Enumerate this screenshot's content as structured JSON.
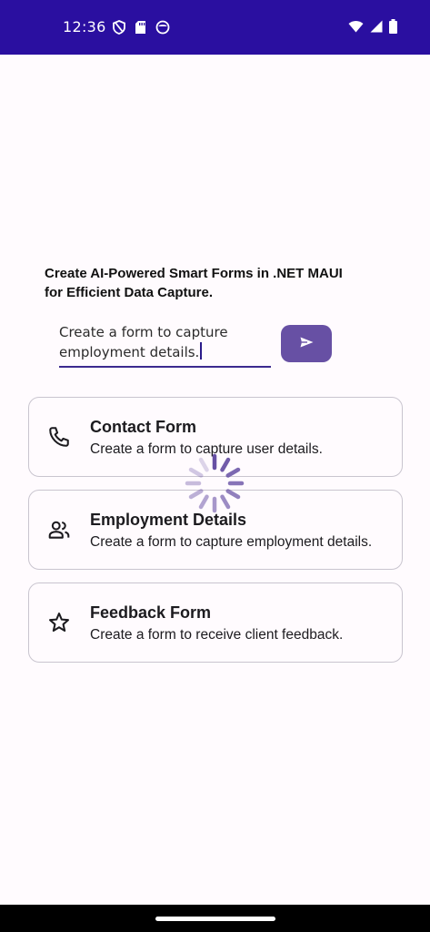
{
  "status_bar": {
    "time": "12:36",
    "left_icons": [
      "shield-icon",
      "sd-card-icon",
      "app-notification-icon"
    ],
    "right_icons": [
      "wifi-icon",
      "cell-signal-icon",
      "battery-icon"
    ]
  },
  "heading": {
    "line1": "Create AI-Powered Smart Forms in .NET MAUI",
    "line2": "for Efficient Data Capture."
  },
  "prompt": {
    "line1": "Create a form to capture",
    "line2": "employment details."
  },
  "send_button": {
    "icon": "send-icon"
  },
  "cards": [
    {
      "icon": "phone-icon",
      "title": "Contact Form",
      "description": "Create a form to capture user details."
    },
    {
      "icon": "people-icon",
      "title": "Employment Details",
      "description": "Create a form to capture employment details."
    },
    {
      "icon": "star-icon",
      "title": "Feedback Form",
      "description": "Create a form to receive client feedback."
    }
  ],
  "colors": {
    "status_bar": "#2a0fa0",
    "accent": "#6750a4",
    "input_underline": "#3b2a8f",
    "card_border": "#c9c5cf",
    "background": "#fffbfe"
  }
}
